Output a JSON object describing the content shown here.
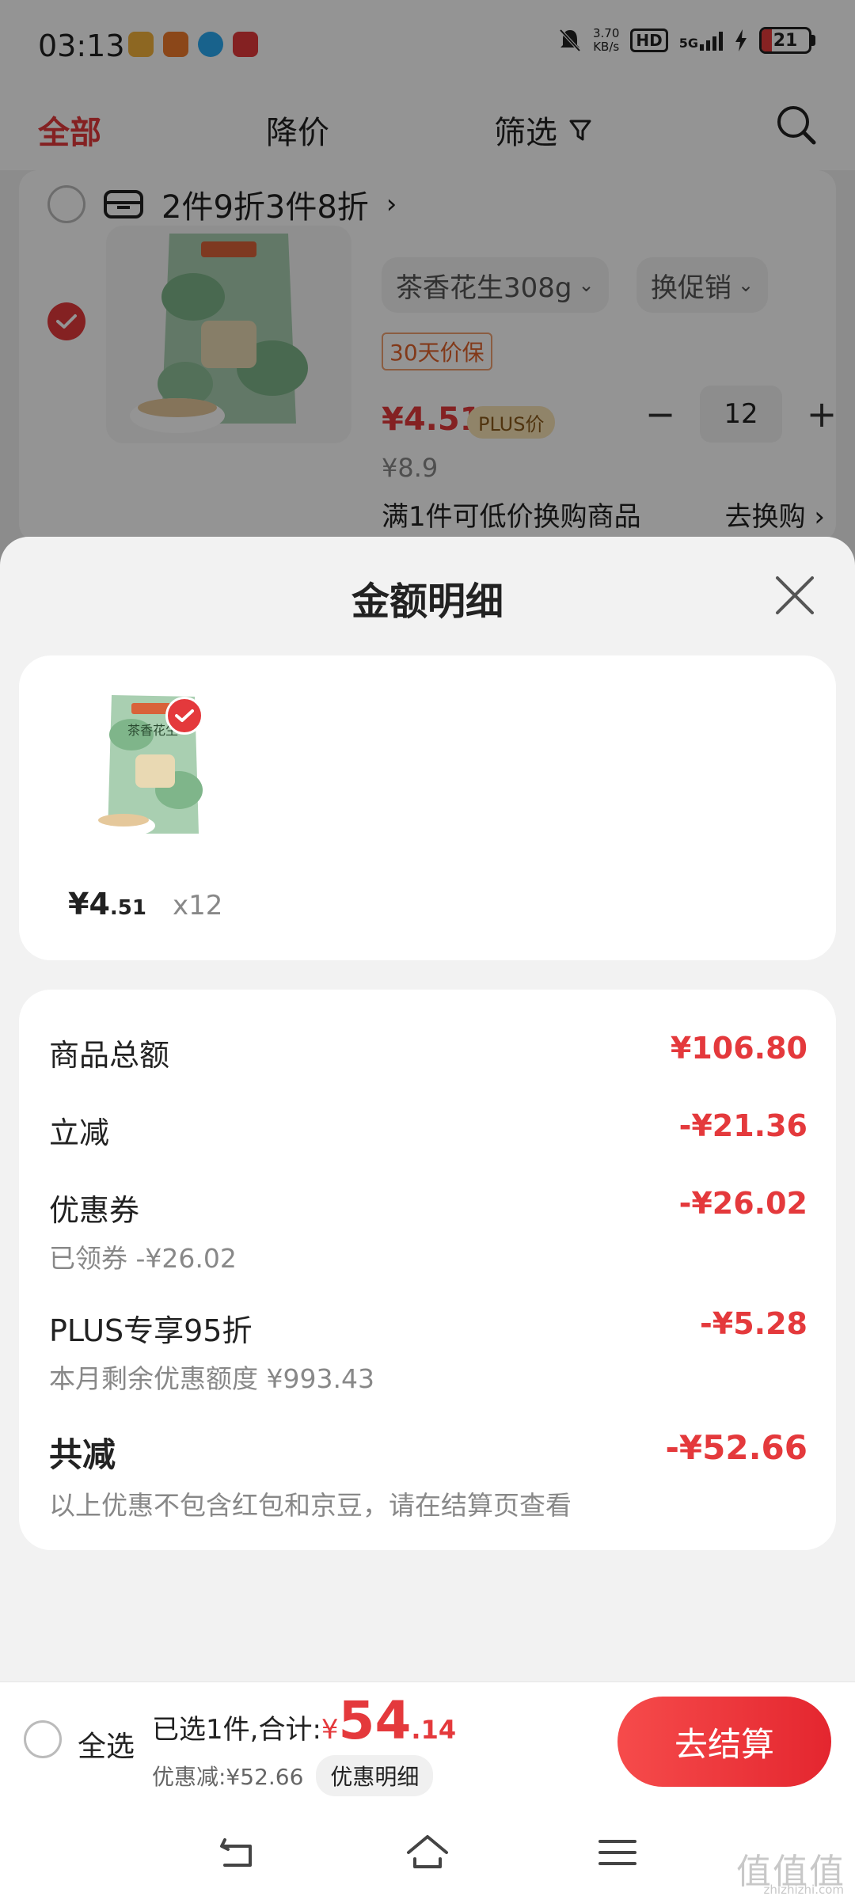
{
  "status_bar": {
    "time": "03:13",
    "net_speed_value": "3.70",
    "net_speed_unit": "KB/s",
    "hd": "HD",
    "network": "5G",
    "battery": "21",
    "battery_level_pct": 21
  },
  "top_tabs": {
    "all": "全部",
    "price_drop": "降价",
    "filter": "筛选"
  },
  "cart": {
    "promo": "2件9折3件8折",
    "spec_label": "茶香花生308g",
    "change_promo": "换促销",
    "guarantee": "30天价保",
    "price_now": "¥4.51",
    "plus_badge": "PLUS价",
    "quantity": "12",
    "price_original": "¥8.9",
    "exchange_text": "满1件可低价换购商品",
    "exchange_link": "去换购"
  },
  "sheet": {
    "title": "金额明细",
    "item": {
      "price_symbol": "¥",
      "price_int": "4",
      "price_dec": ".51",
      "qty": "x12",
      "package_text": "茶香花生"
    },
    "details": [
      {
        "label": "商品总额",
        "value": "¥106.80",
        "sub": ""
      },
      {
        "label": "立减",
        "value": "-¥21.36",
        "sub": ""
      },
      {
        "label": "优惠券",
        "value": "-¥26.02",
        "sub": "已领券 -¥26.02"
      },
      {
        "label": "PLUS专享95折",
        "value": "-¥5.28",
        "sub": "本月剩余优惠额度 ¥993.43"
      },
      {
        "label": "共减",
        "value": "-¥52.66",
        "sub": "以上优惠不包含红包和京豆，请在结算页查看"
      }
    ]
  },
  "bottom_bar": {
    "select_all": "全选",
    "selected_prefix": "已选1件,合计:",
    "total_symbol": "¥",
    "total_int": "54",
    "total_dec": ".14",
    "discount_text": "优惠减:¥52.66",
    "detail_button": "优惠明细",
    "checkout": "去结算"
  },
  "watermark": {
    "main": "值值值",
    "sub": "zhizhizhi.com"
  },
  "colors": {
    "accent": "#e4393c",
    "background": "#f2f2f2"
  }
}
